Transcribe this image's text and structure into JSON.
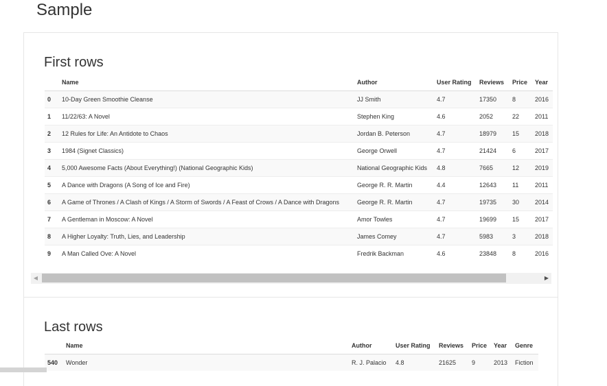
{
  "page": {
    "title": "Sample"
  },
  "first_rows": {
    "title": "First rows",
    "columns": [
      "",
      "Name",
      "Author",
      "User Rating",
      "Reviews",
      "Price",
      "Year"
    ],
    "rows": [
      [
        "0",
        "10-Day Green Smoothie Cleanse",
        "JJ Smith",
        "4.7",
        "17350",
        "8",
        "2016"
      ],
      [
        "1",
        "11/22/63: A Novel",
        "Stephen King",
        "4.6",
        "2052",
        "22",
        "2011"
      ],
      [
        "2",
        "12 Rules for Life: An Antidote to Chaos",
        "Jordan B. Peterson",
        "4.7",
        "18979",
        "15",
        "2018"
      ],
      [
        "3",
        "1984 (Signet Classics)",
        "George Orwell",
        "4.7",
        "21424",
        "6",
        "2017"
      ],
      [
        "4",
        "5,000 Awesome Facts (About Everything!) (National Geographic Kids)",
        "National Geographic Kids",
        "4.8",
        "7665",
        "12",
        "2019"
      ],
      [
        "5",
        "A Dance with Dragons (A Song of Ice and Fire)",
        "George R. R. Martin",
        "4.4",
        "12643",
        "11",
        "2011"
      ],
      [
        "6",
        "A Game of Thrones / A Clash of Kings / A Storm of Swords / A Feast of Crows / A Dance with Dragons",
        "George R. R. Martin",
        "4.7",
        "19735",
        "30",
        "2014"
      ],
      [
        "7",
        "A Gentleman in Moscow: A Novel",
        "Amor Towles",
        "4.7",
        "19699",
        "15",
        "2017"
      ],
      [
        "8",
        "A Higher Loyalty: Truth, Lies, and Leadership",
        "James Comey",
        "4.7",
        "5983",
        "3",
        "2018"
      ],
      [
        "9",
        "A Man Called Ove: A Novel",
        "Fredrik Backman",
        "4.6",
        "23848",
        "8",
        "2016"
      ]
    ]
  },
  "last_rows": {
    "title": "Last rows",
    "columns": [
      "",
      "Name",
      "Author",
      "User Rating",
      "Reviews",
      "Price",
      "Year",
      "Genre"
    ],
    "rows": [
      [
        "540",
        "Wonder",
        "R. J. Palacio",
        "4.8",
        "21625",
        "9",
        "2013",
        "Fiction"
      ]
    ]
  }
}
